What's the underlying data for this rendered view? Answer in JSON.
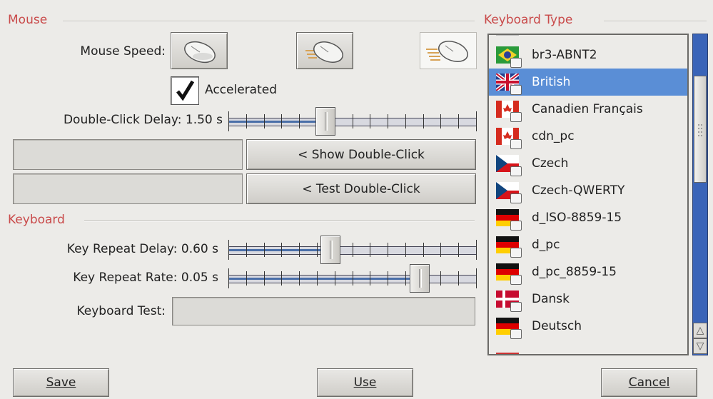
{
  "mouse": {
    "section_title": "Mouse",
    "speed_label": "Mouse Speed:",
    "speed_options": [
      "slow-mouse-icon",
      "medium-mouse-icon",
      "fast-mouse-icon"
    ],
    "accelerated_label": "Accelerated",
    "accelerated_checked": true,
    "double_click_label": "Double-Click Delay: 1.50 s",
    "double_click_fraction": 0.39,
    "show_double_click_label": "< Show Double-Click",
    "test_double_click_label": "< Test Double-Click"
  },
  "keyboard": {
    "section_title": "Keyboard",
    "repeat_delay_label": "Key Repeat Delay: 0.60 s",
    "repeat_delay_fraction": 0.41,
    "repeat_rate_label": "Key Repeat Rate: 0.05 s",
    "repeat_rate_fraction": 0.77,
    "test_label": "Keyboard Test:",
    "test_value": ""
  },
  "keyboard_type": {
    "section_title": "Keyboard Type",
    "items": [
      {
        "label": "br3-ABNT2",
        "flag": "brazil",
        "selected": false
      },
      {
        "label": "British",
        "flag": "uk",
        "selected": true
      },
      {
        "label": "Canadien Français",
        "flag": "canada",
        "selected": false
      },
      {
        "label": "cdn_pc",
        "flag": "canada",
        "selected": false
      },
      {
        "label": "Czech",
        "flag": "czech",
        "selected": false
      },
      {
        "label": "Czech-QWERTY",
        "flag": "czech",
        "selected": false
      },
      {
        "label": "d_ISO-8859-15",
        "flag": "germany",
        "selected": false
      },
      {
        "label": "d_pc",
        "flag": "germany",
        "selected": false
      },
      {
        "label": "d_pc_8859-15",
        "flag": "germany",
        "selected": false
      },
      {
        "label": "Dansk",
        "flag": "denmark",
        "selected": false
      },
      {
        "label": "Deutsch",
        "flag": "germany",
        "selected": false
      }
    ],
    "colors": {
      "selection": "#5a8ed6",
      "scrollbar": "#3a64b8"
    }
  },
  "footer": {
    "save_label": "Save",
    "use_label": "Use",
    "cancel_label": "Cancel"
  },
  "colors": {
    "section_title": "#c94a4a",
    "background": "#ecebe8",
    "slider_fill": "#4a6fa8"
  }
}
